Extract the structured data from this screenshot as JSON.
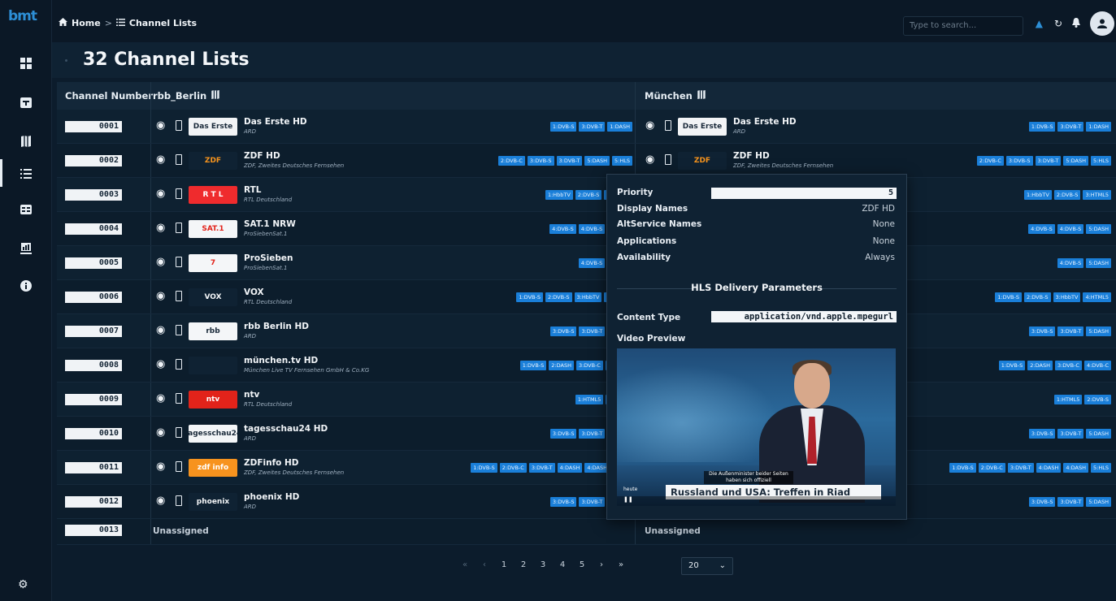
{
  "app": {
    "logo_text": "bmt"
  },
  "colors": {
    "background": "#0c1c2c",
    "accent": "#1a7fd9",
    "row_odd": "#0e2131",
    "row_even": "#0c1d2c"
  },
  "breadcrumb": {
    "home": "Home",
    "sep": ">",
    "current": "Channel Lists"
  },
  "search": {
    "placeholder": "Type to search..."
  },
  "page": {
    "title": "32 Channel Lists"
  },
  "table": {
    "headers": {
      "channel_number": "Channel Number",
      "list1": "rbb_Berlin",
      "list2": "München"
    },
    "rows": [
      {
        "num": "0001",
        "name": "Das Erste HD",
        "prov": "ARD",
        "logo": "Das Erste",
        "tags": [
          "1:DVB-S",
          "3:DVB-T",
          "1:DASH"
        ]
      },
      {
        "num": "0002",
        "name": "ZDF HD",
        "prov": "ZDF, Zweites Deutsches Fernsehen",
        "logo": "ZDF",
        "tags": [
          "2:DVB-C",
          "3:DVB-S",
          "3:DVB-T",
          "5:DASH",
          "5:HLS"
        ]
      },
      {
        "num": "0003",
        "name": "RTL",
        "prov": "RTL Deutschland",
        "logo": "R T L",
        "tags": [
          "1:HbbTV",
          "2:DVB-S",
          "3:HTML5"
        ]
      },
      {
        "num": "0004",
        "name": "SAT.1 NRW",
        "prov": "ProSiebenSat.1",
        "logo": "SAT.1",
        "tags": [
          "4:DVB-S",
          "4:DVB-S",
          "5:DASH"
        ]
      },
      {
        "num": "0005",
        "name": "ProSieben",
        "prov": "ProSiebenSat.1",
        "logo": "7",
        "tags": [
          "4:DVB-S",
          "5:DASH"
        ]
      },
      {
        "num": "0006",
        "name": "VOX",
        "prov": "RTL Deutschland",
        "logo": "VOX",
        "tags": [
          "1:DVB-S",
          "2:DVB-S",
          "3:HbbTV",
          "4:HTML5"
        ]
      },
      {
        "num": "0007",
        "name": "rbb Berlin HD",
        "prov": "ARD",
        "logo": "rbb",
        "tags": [
          "3:DVB-S",
          "3:DVB-T",
          "5:DASH"
        ]
      },
      {
        "num": "0008",
        "name": "münchen.tv HD",
        "prov": "München Live TV Fernsehen GmbH & Co.KG",
        "logo": "",
        "tags": [
          "1:DVB-S",
          "2:DASH",
          "3:DVB-C",
          "4:DVB-C"
        ]
      },
      {
        "num": "0009",
        "name": "ntv",
        "prov": "RTL Deutschland",
        "logo": "ntv",
        "tags": [
          "1:HTML5",
          "2:DVB-S"
        ]
      },
      {
        "num": "0010",
        "name": "tagesschau24 HD",
        "prov": "ARD",
        "logo": "tagesschau24",
        "tags": [
          "3:DVB-S",
          "3:DVB-T",
          "5:DASH"
        ]
      },
      {
        "num": "0011",
        "name": "ZDFinfo HD",
        "prov": "ZDF, Zweites Deutsches Fernsehen",
        "logo": "zdf info",
        "tags": [
          "1:DVB-S",
          "2:DVB-C",
          "3:DVB-T",
          "4:DASH",
          "4:DASH",
          "5:HLS"
        ]
      },
      {
        "num": "0012",
        "name": "phoenix HD",
        "prov": "ARD",
        "logo": "phoenix",
        "tags": [
          "3:DVB-S",
          "3:DVB-T",
          "5:DASH"
        ]
      }
    ],
    "last_row": {
      "num": "0013",
      "left": "Unassigned",
      "right": "Unassigned"
    }
  },
  "popup": {
    "priority_label": "Priority",
    "priority_value": "5",
    "display_names_label": "Display Names",
    "display_names_value": "ZDF HD",
    "altservice_label": "AltService Names",
    "altservice_value": "None",
    "applications_label": "Applications",
    "applications_value": "None",
    "availability_label": "Availability",
    "availability_value": "Always",
    "hls_title": "HLS Delivery Parameters",
    "content_type_label": "Content Type",
    "content_type_value": "application/vnd.apple.mpegurl",
    "video_preview_label": "Video Preview",
    "video_subtitle": "Die Außenminister beider Seiten haben sich offiziell",
    "video_banner": "Russland und USA: Treffen in Riad",
    "video_brand": "heute"
  },
  "pagination": {
    "first": "«",
    "prev": "‹",
    "pages": [
      "1",
      "2",
      "3",
      "4",
      "5"
    ],
    "next": "›",
    "last": "»",
    "page_size": "20"
  }
}
